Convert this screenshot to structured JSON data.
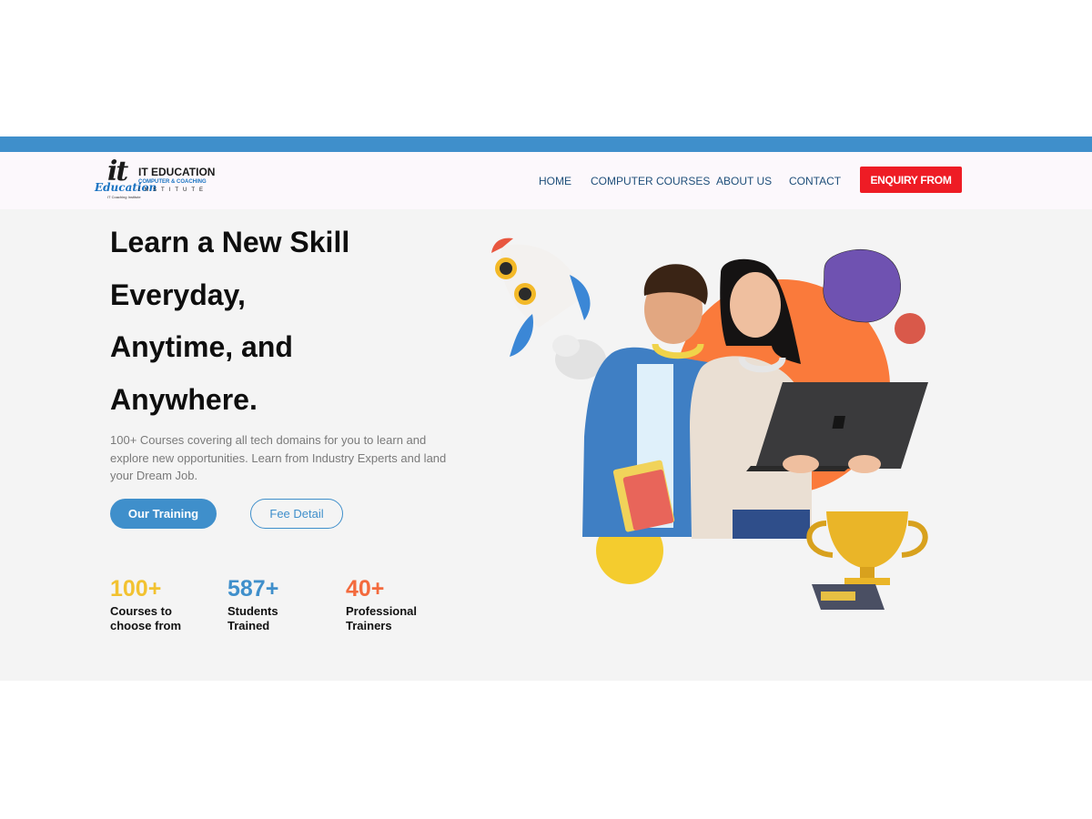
{
  "logo": {
    "mark": "it",
    "script": "Education",
    "tagline": "IT Coaching Institute",
    "name": "IT EDUCATION",
    "subtitle": "COMPUTER & COACHING",
    "institute": "INSTITUTE"
  },
  "nav": {
    "items": [
      {
        "label": "HOME"
      },
      {
        "label": "COMPUTER COURSES"
      },
      {
        "label": "ABOUT US"
      },
      {
        "label": "CONTACT"
      }
    ],
    "cta_label": "ENQUIRY FROM"
  },
  "hero": {
    "headline_lines": [
      "Learn a New Skill",
      "Everyday,",
      "Anytime, and",
      "Anywhere."
    ],
    "description": "100+ Courses covering all tech domains for you to learn and explore new opportunities. Learn from Industry Experts and land your Dream Job.",
    "primary_button": "Our Training",
    "secondary_button": "Fee Detail"
  },
  "stats": [
    {
      "value": "100+",
      "label": "Courses to choose from",
      "color": "#f2c230"
    },
    {
      "value": "587+",
      "label": "Students Trained",
      "color": "#3f8fcb"
    },
    {
      "value": "40+",
      "label": "Professional Trainers",
      "color": "#f36a3d"
    }
  ],
  "colors": {
    "topbar": "#3f8fcb",
    "accent_blue": "#3f8fcb",
    "cta_red": "#ee1c25",
    "hero_bg": "#f4f4f4",
    "orange_circle": "#fa7a3b",
    "purple_blob": "#6f52b1"
  },
  "illustration": {
    "elements": [
      "rocket-icon",
      "students-photo",
      "laptop",
      "trophy-icon",
      "purple-blob",
      "orange-circle",
      "red-dot",
      "yellow-circle"
    ]
  }
}
